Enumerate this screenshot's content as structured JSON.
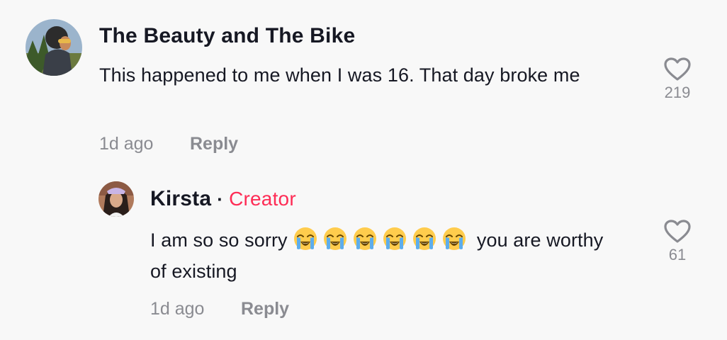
{
  "comment": {
    "username": "The Beauty and The Bike",
    "text": "This happened to me when I was 16. That day broke me",
    "timestamp": "1d ago",
    "reply_label": "Reply",
    "likes": "219"
  },
  "reply": {
    "username": "Kirsta",
    "separator": "·",
    "badge": "Creator",
    "text_before": "I am so so sorry",
    "emoji_name": "loudly-crying-face-emoji",
    "emoji_count": 6,
    "text_after": "you are worthy of existing",
    "timestamp": "1d ago",
    "reply_label": "Reply",
    "likes": "61"
  },
  "colors": {
    "background": "#f8f8f8",
    "text": "#161823",
    "muted": "#8a8b91",
    "creator": "#fe2c55"
  },
  "icons": {
    "like": "heart-outline-icon"
  }
}
